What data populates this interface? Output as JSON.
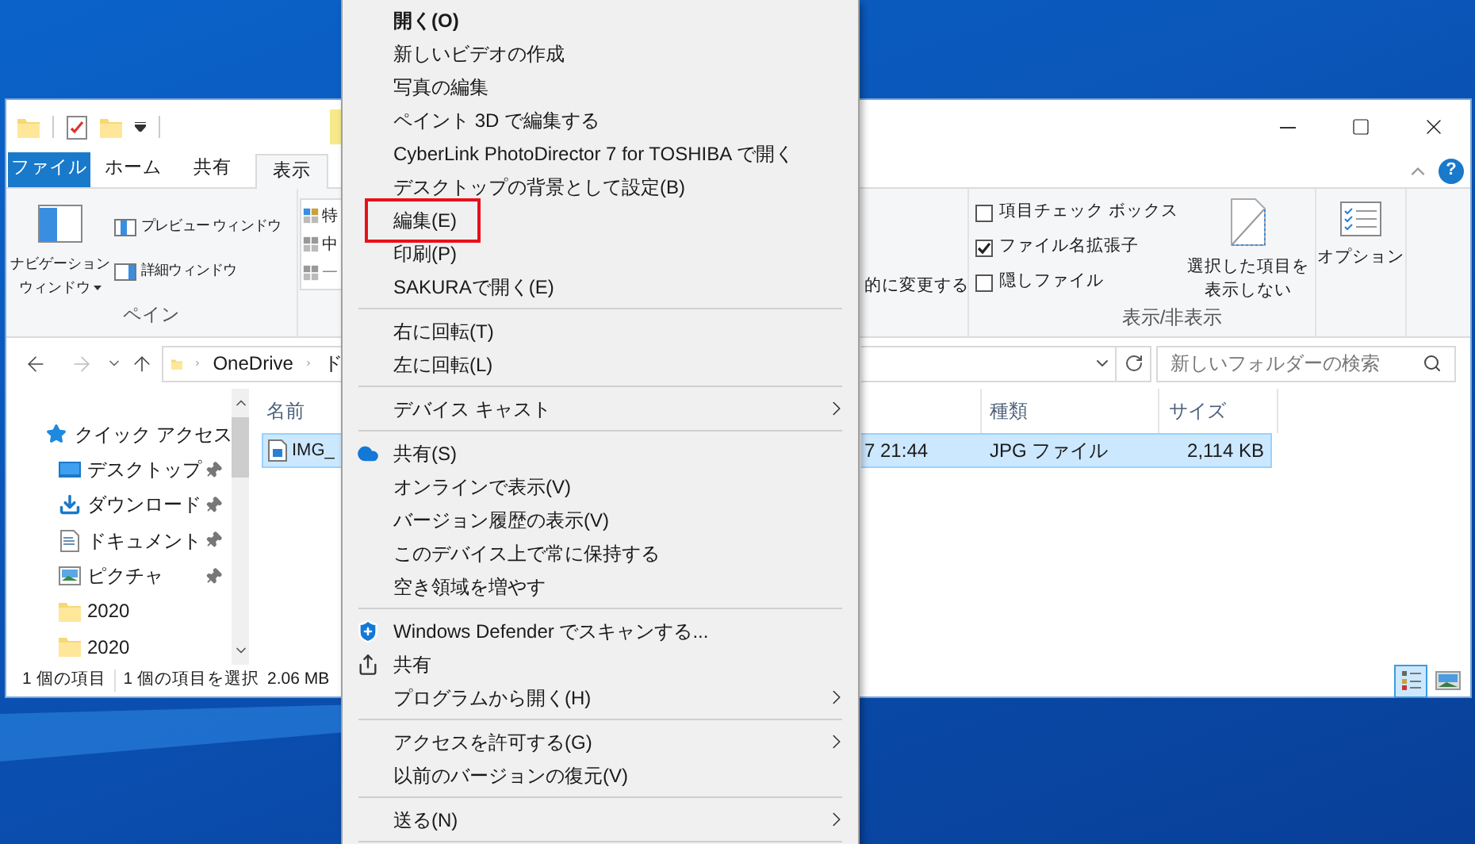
{
  "ribbon_tabs": [
    {
      "label": "ファイル",
      "kind": "file",
      "selected": false
    },
    {
      "label": "ホーム",
      "kind": "tab",
      "selected": false
    },
    {
      "label": "共有",
      "kind": "tab",
      "selected": false
    },
    {
      "label": "表示",
      "kind": "tab",
      "selected": true
    }
  ],
  "ribbon": {
    "nav_pane_button": [
      "ナビゲーション",
      "ウィンドウ"
    ],
    "pane_buttons": [
      "プレビュー ウィンドウ",
      "詳細ウィンドウ"
    ],
    "pane_group_label": "ペイン",
    "layout_gallery": [
      "特",
      "中",
      "一"
    ],
    "partial_label": "的に変更する",
    "checkboxes": [
      {
        "label": "項目チェック ボックス",
        "checked": false
      },
      {
        "label": "ファイル名拡張子",
        "checked": true
      },
      {
        "label": "隠しファイル",
        "checked": false
      }
    ],
    "hide_selected_button": [
      "選択した項目を",
      "表示しない"
    ],
    "show_hide_group_label": "表示/非表示",
    "options_button": "オプション"
  },
  "address_bar": {
    "crumbs": [
      "OneDrive",
      "ド"
    ]
  },
  "search": {
    "placeholder": "新しいフォルダーの検索"
  },
  "nav_pane": {
    "items": [
      {
        "label": "クイック アクセス",
        "kind": "star",
        "pinned": false,
        "children": [
          {
            "label": "デスクトップ",
            "kind": "desktop",
            "pinned": true
          },
          {
            "label": "ダウンロード",
            "kind": "download",
            "pinned": true
          },
          {
            "label": "ドキュメント",
            "kind": "document",
            "pinned": true
          },
          {
            "label": "ピクチャ",
            "kind": "picture",
            "pinned": true
          },
          {
            "label": "2020",
            "kind": "folder",
            "pinned": false
          },
          {
            "label": "2020",
            "kind": "folder",
            "pinned": false
          }
        ]
      }
    ]
  },
  "file_list": {
    "columns": [
      "名前",
      "種類",
      "サイズ"
    ],
    "rows": [
      {
        "name": "IMG_",
        "date": "7 21:44",
        "type": "JPG ファイル",
        "size": "2,114 KB",
        "selected": true
      }
    ]
  },
  "help_button": "?",
  "status_bar": {
    "item_count": "1 個の項目",
    "selection": "1 個の項目を選択",
    "selection_size": "2.06 MB",
    "views": [
      {
        "kind": "details",
        "selected": true
      },
      {
        "kind": "large-icons",
        "selected": false
      }
    ]
  },
  "context_menu": {
    "items": [
      {
        "label": "開く(O)",
        "kind": "item",
        "default": true,
        "submenu": false,
        "outlined": false
      },
      {
        "label": "新しいビデオの作成",
        "kind": "item",
        "default": false,
        "submenu": false,
        "outlined": false
      },
      {
        "label": "写真の編集",
        "kind": "item",
        "default": false,
        "submenu": false,
        "outlined": false
      },
      {
        "label": "ペイント 3D で編集する",
        "kind": "item",
        "default": false,
        "submenu": false,
        "outlined": false
      },
      {
        "label": "CyberLink PhotoDirector 7 for TOSHIBA で開く",
        "kind": "item",
        "default": false,
        "submenu": false,
        "outlined": false
      },
      {
        "label": "デスクトップの背景として設定(B)",
        "kind": "item",
        "default": false,
        "submenu": false,
        "outlined": false
      },
      {
        "label": "編集(E)",
        "kind": "item",
        "default": false,
        "submenu": false,
        "outlined": true
      },
      {
        "label": "印刷(P)",
        "kind": "item",
        "default": false,
        "submenu": false,
        "outlined": false
      },
      {
        "label": "SAKURAで開く(E)",
        "kind": "item",
        "default": false,
        "submenu": false,
        "outlined": false
      },
      {
        "kind": "separator"
      },
      {
        "label": "右に回転(T)",
        "kind": "item",
        "default": false,
        "submenu": false,
        "outlined": false
      },
      {
        "label": "左に回転(L)",
        "kind": "item",
        "default": false,
        "submenu": false,
        "outlined": false
      },
      {
        "kind": "separator"
      },
      {
        "label": "デバイス キャスト",
        "kind": "item",
        "default": false,
        "submenu": true,
        "outlined": false
      },
      {
        "kind": "separator"
      },
      {
        "label": "共有(S)",
        "kind": "cloud",
        "default": false,
        "submenu": false,
        "outlined": false
      },
      {
        "label": "オンラインで表示(V)",
        "kind": "item",
        "default": false,
        "submenu": false,
        "outlined": false
      },
      {
        "label": "バージョン履歴の表示(V)",
        "kind": "item",
        "default": false,
        "submenu": false,
        "outlined": false
      },
      {
        "label": "このデバイス上で常に保持する",
        "kind": "item",
        "default": false,
        "submenu": false,
        "outlined": false
      },
      {
        "label": "空き領域を増やす",
        "kind": "item",
        "default": false,
        "submenu": false,
        "outlined": false
      },
      {
        "kind": "separator"
      },
      {
        "label": "Windows Defender でスキャンする...",
        "kind": "shield",
        "default": false,
        "submenu": false,
        "outlined": false
      },
      {
        "label": "共有",
        "kind": "share",
        "default": false,
        "submenu": false,
        "outlined": false
      },
      {
        "label": "プログラムから開く(H)",
        "kind": "item",
        "default": false,
        "submenu": true,
        "outlined": false
      },
      {
        "kind": "separator"
      },
      {
        "label": "アクセスを許可する(G)",
        "kind": "item",
        "default": false,
        "submenu": true,
        "outlined": false
      },
      {
        "label": "以前のバージョンの復元(V)",
        "kind": "item",
        "default": false,
        "submenu": false,
        "outlined": false
      },
      {
        "kind": "separator"
      },
      {
        "label": "送る(N)",
        "kind": "item",
        "default": false,
        "submenu": true,
        "outlined": false
      },
      {
        "kind": "separator"
      }
    ]
  }
}
